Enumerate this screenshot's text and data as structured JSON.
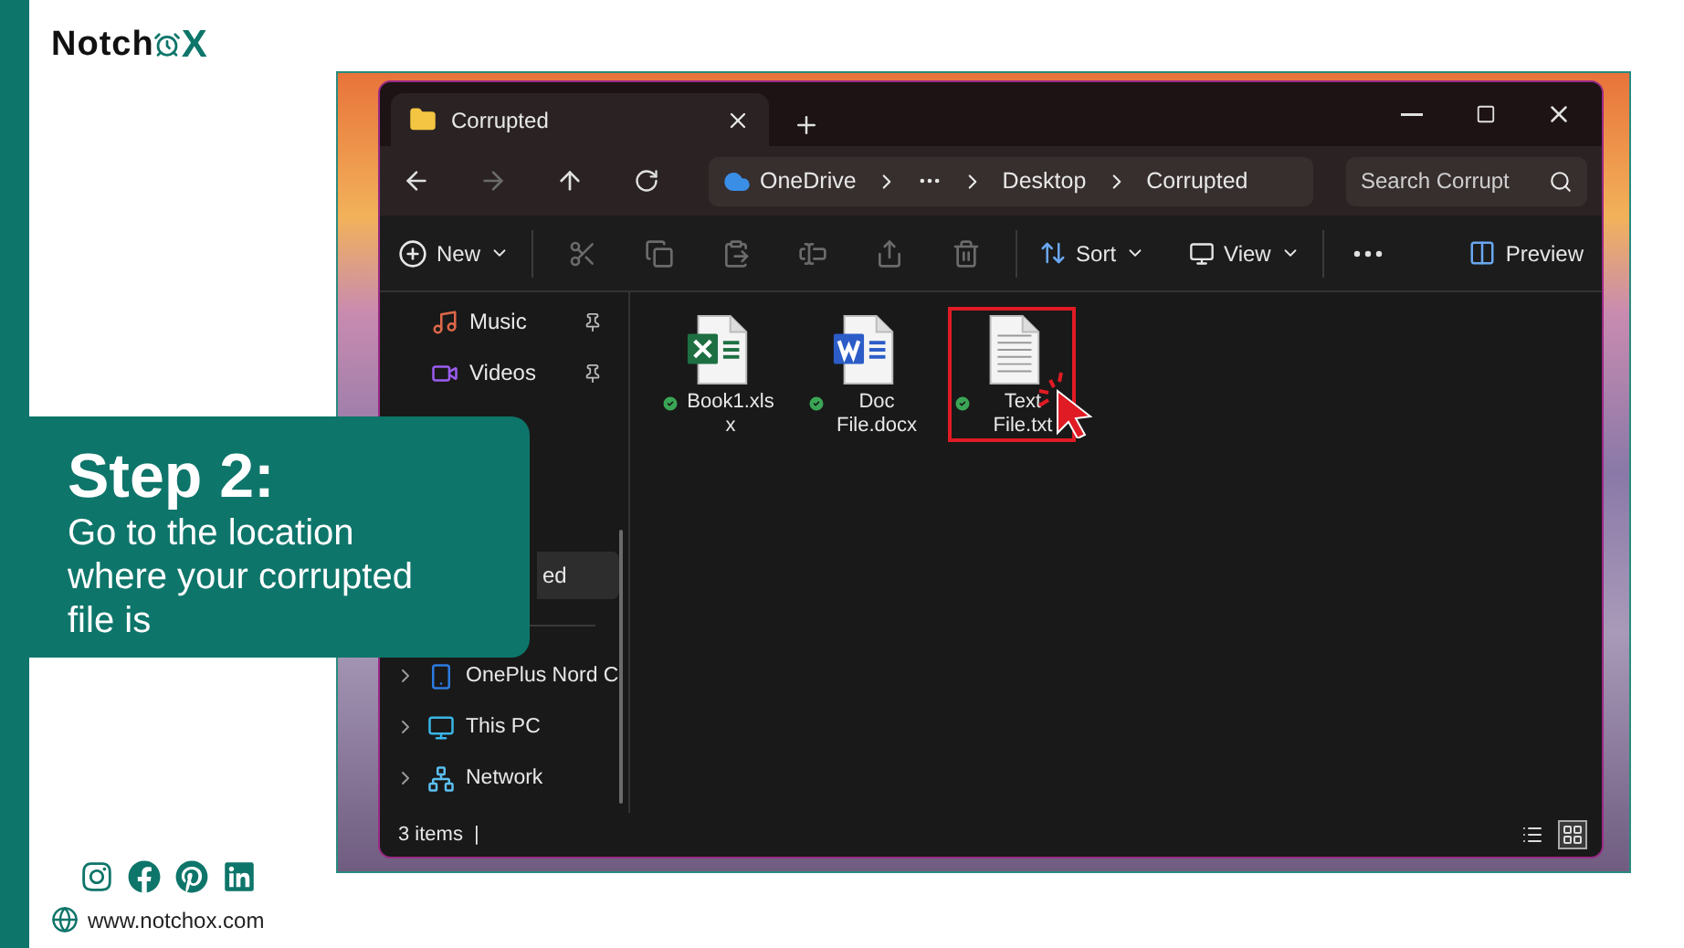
{
  "logo": {
    "start": "Notch",
    "end": "X"
  },
  "explorer": {
    "tab_title": "Corrupted",
    "breadcrumbs": [
      {
        "kind": "cloud",
        "label": "OneDrive"
      },
      {
        "kind": "more"
      },
      {
        "kind": "folder",
        "label": "Desktop"
      },
      {
        "kind": "folder",
        "label": "Corrupted"
      }
    ],
    "search": {
      "placeholder": "Search Corrupt"
    },
    "toolbar": {
      "new": "New",
      "sort": "Sort",
      "view": "View",
      "preview": "Preview"
    },
    "actions": [
      {
        "kind": "cut",
        "disabled": true
      },
      {
        "kind": "copy",
        "disabled": true
      },
      {
        "kind": "paste",
        "disabled": true
      },
      {
        "kind": "rename",
        "disabled": true
      },
      {
        "kind": "share",
        "disabled": true
      },
      {
        "kind": "delete",
        "disabled": true
      }
    ],
    "quick_access": [
      {
        "kind": "music",
        "label": "Music",
        "pinned": true
      },
      {
        "kind": "videos",
        "label": "Videos",
        "pinned": true
      }
    ],
    "current_item": {
      "label": "ed",
      "selected": true
    },
    "locations": [
      {
        "kind": "phone",
        "label": "OnePlus Nord C"
      },
      {
        "kind": "pc",
        "label": "This PC"
      },
      {
        "kind": "network",
        "label": "Network"
      }
    ],
    "files": [
      {
        "kind": "spreadsheet",
        "name": "Book1.xlsx",
        "synced": true,
        "highlighted": false
      },
      {
        "kind": "document",
        "name": "Doc File.docx",
        "synced": true,
        "highlighted": false
      },
      {
        "kind": "text",
        "name": "Text File.txt",
        "synced": true,
        "highlighted": true
      }
    ],
    "status": {
      "count": "3 items",
      "separator": "|"
    },
    "view_modes": [
      {
        "kind": "details",
        "selected": false
      },
      {
        "kind": "tiles",
        "selected": true
      }
    ]
  },
  "step": {
    "title": "Step 2:",
    "text": "Go to the location where your corrupted file is"
  },
  "footer": {
    "socials": [
      {
        "kind": "instagram"
      },
      {
        "kind": "facebook"
      },
      {
        "kind": "pinterest"
      },
      {
        "kind": "linkedin"
      }
    ],
    "website": "www.notchox.com"
  }
}
